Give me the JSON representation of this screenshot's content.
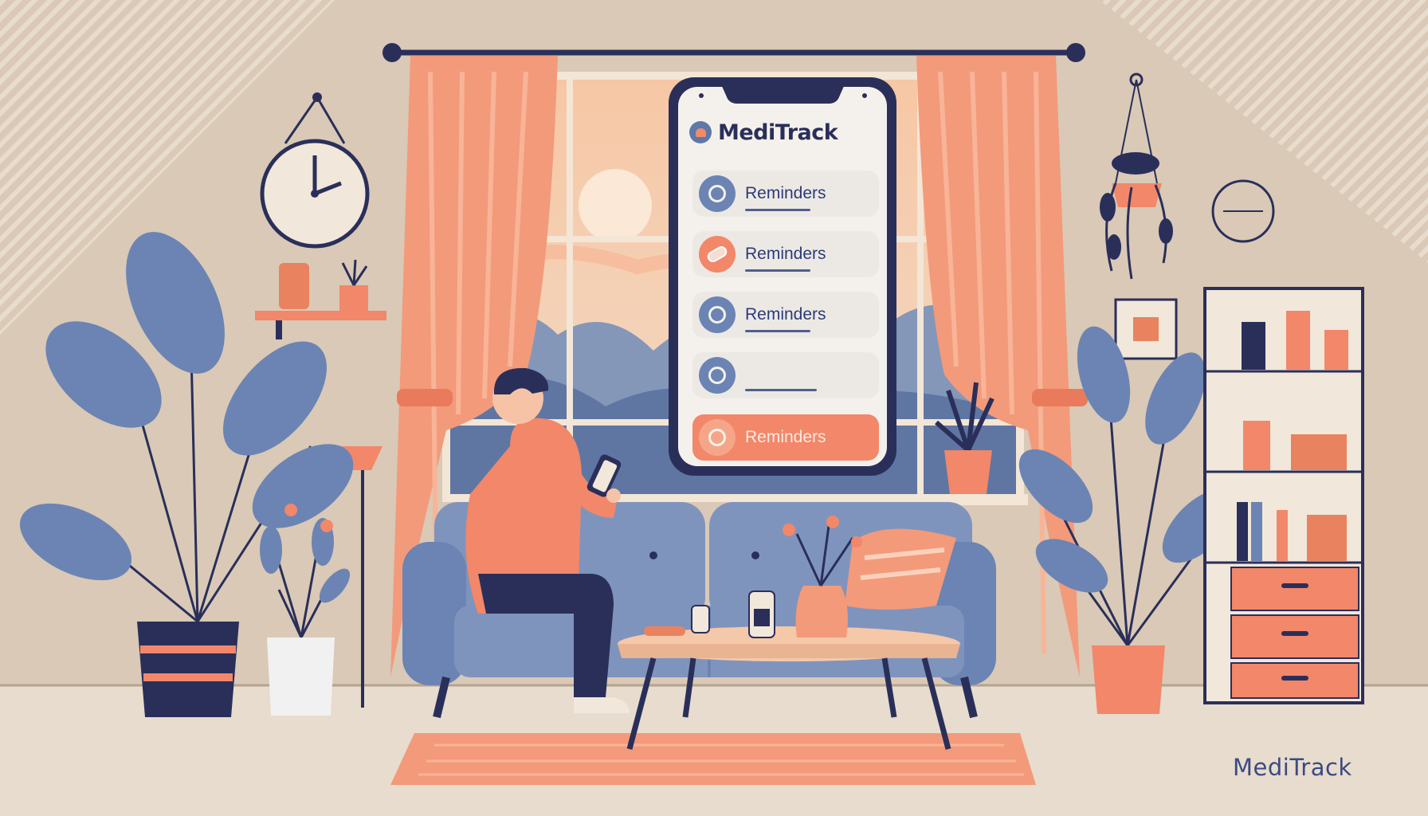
{
  "app": {
    "name": "MediTrack",
    "items": [
      {
        "label": "Reminders",
        "icon": "heart-pin-icon"
      },
      {
        "label": "Reminders",
        "icon": "pill-icon"
      },
      {
        "label": "Reminders",
        "icon": "heart-icon"
      },
      {
        "label": "",
        "icon": "at-icon"
      },
      {
        "label": "Reminders",
        "icon": "pill-box-icon"
      }
    ]
  },
  "watermark": "MediTrack",
  "colors": {
    "wall": "#d9c9b6",
    "coral": "#f2876a",
    "slate_blue": "#6b84b4",
    "navy": "#2a2f5a"
  }
}
